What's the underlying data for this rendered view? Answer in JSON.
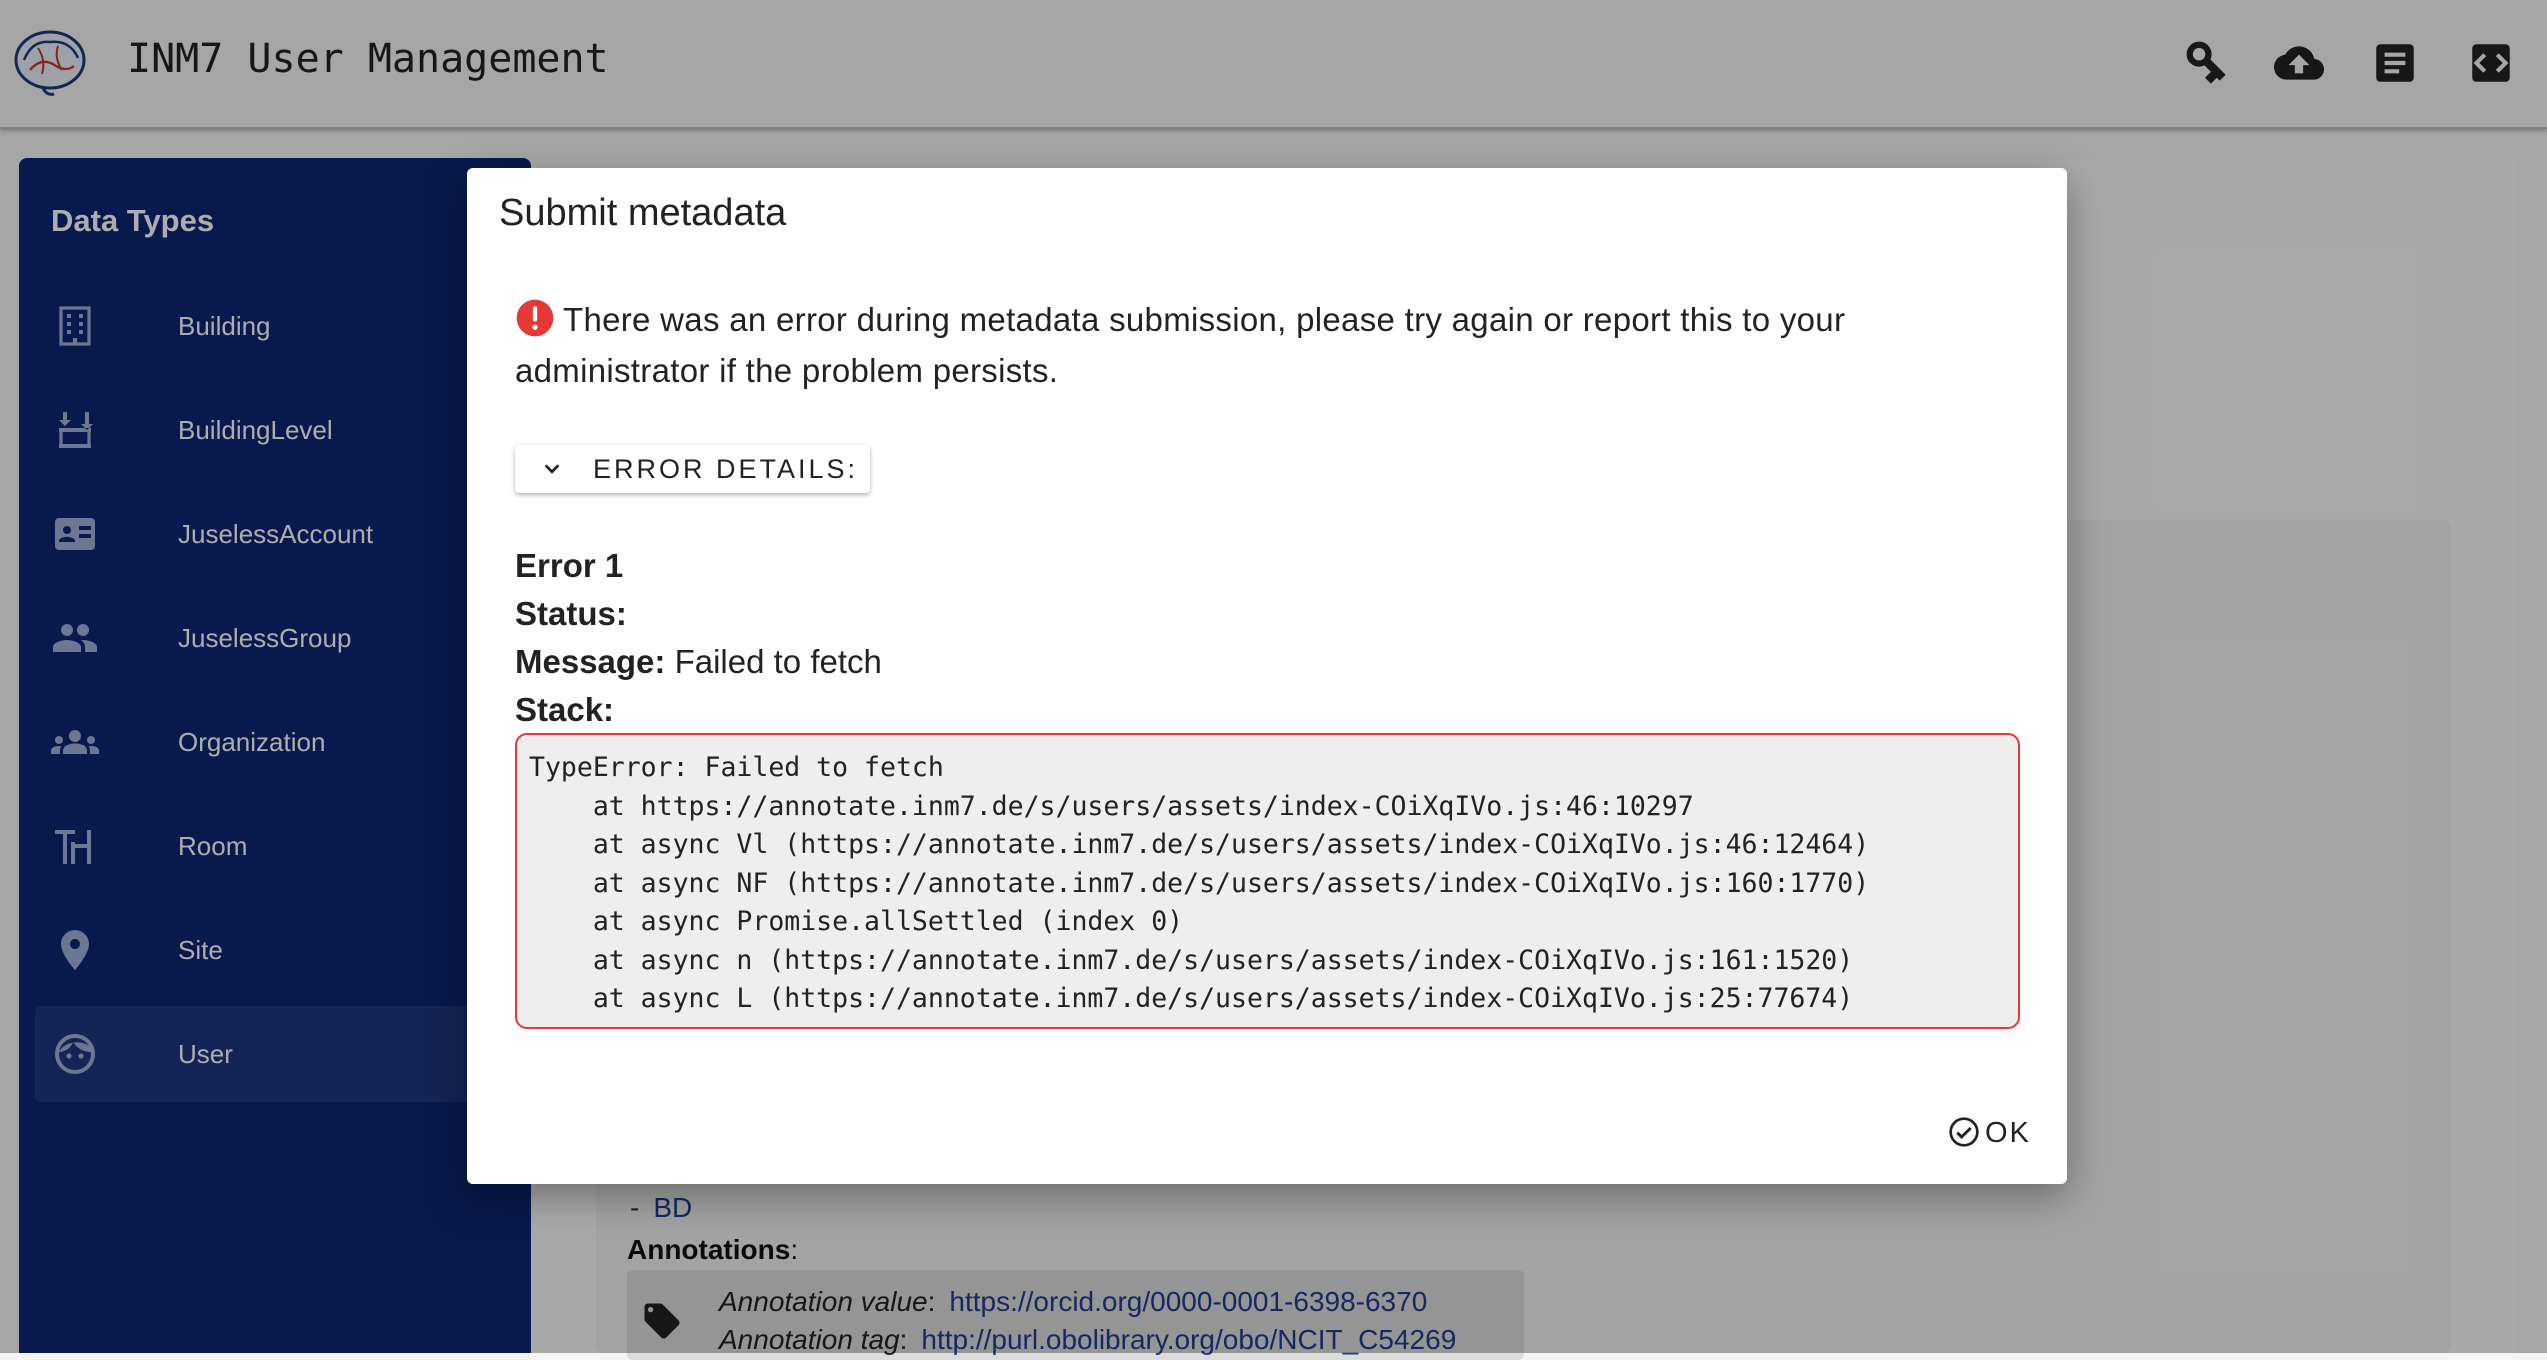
{
  "header": {
    "title": "INM7 User Management",
    "icons": [
      "key-icon",
      "cloud-upload-icon",
      "document-icon",
      "code-icon"
    ]
  },
  "sidebar": {
    "title": "Data Types",
    "items": [
      {
        "label": "Building",
        "icon": "building-icon"
      },
      {
        "label": "BuildingLevel",
        "icon": "building-level-icon"
      },
      {
        "label": "JuselessAccount",
        "icon": "account-card-icon"
      },
      {
        "label": "JuselessGroup",
        "icon": "group-icon"
      },
      {
        "label": "Organization",
        "icon": "organization-icon"
      },
      {
        "label": "Room",
        "icon": "room-icon"
      },
      {
        "label": "Site",
        "icon": "location-pin-icon"
      },
      {
        "label": "User",
        "icon": "user-face-icon",
        "active": true
      }
    ]
  },
  "background": {
    "bd_item": "BD",
    "annotations_label": "Annotations",
    "annotation": {
      "value_label": "Annotation value",
      "value": "https://orcid.org/0000-0001-6398-6370",
      "tag_label": "Annotation tag",
      "tag": "http://purl.obolibrary.org/obo/NCIT_C54269"
    }
  },
  "dialog": {
    "title": "Submit metadata",
    "error_message": "There was an error during metadata submission, please try again or report this to your administrator if the problem persists.",
    "details_toggle_label": "ERROR DETAILS:",
    "error_heading": "Error 1",
    "status_label": "Status:",
    "status_value": "",
    "message_label": "Message:",
    "message_value": "Failed to fetch",
    "stack_label": "Stack:",
    "stack_lines": [
      "TypeError: Failed to fetch",
      "    at https://annotate.inm7.de/s/users/assets/index-COiXqIVo.js:46:10297",
      "    at async Vl (https://annotate.inm7.de/s/users/assets/index-COiXqIVo.js:46:12464)",
      "    at async NF (https://annotate.inm7.de/s/users/assets/index-COiXqIVo.js:160:1770)",
      "    at async Promise.allSettled (index 0)",
      "    at async n (https://annotate.inm7.de/s/users/assets/index-COiXqIVo.js:161:1520)",
      "    at async L (https://annotate.inm7.de/s/users/assets/index-COiXqIVo.js:25:77674)"
    ],
    "ok_label": "OK"
  },
  "colors": {
    "sidebar_bg": "#0d2772",
    "sidebar_active": "#1d367f",
    "error_red": "#e53935",
    "link": "#1f3b8f"
  }
}
